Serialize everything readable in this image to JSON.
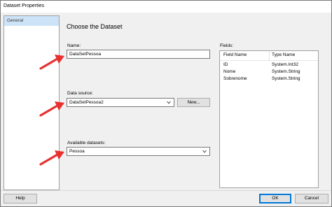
{
  "window": {
    "title": "Dataset Properties"
  },
  "sidebar": {
    "items": [
      {
        "label": "General"
      }
    ]
  },
  "main": {
    "heading": "Choose the Dataset",
    "name_label": "Name:",
    "name_value": "DataSetPessoa",
    "datasource_label": "Data source:",
    "datasource_value": "DataSetPessoa2",
    "new_button": "New...",
    "available_label": "Available datasets:",
    "available_value": "Pessoa"
  },
  "fields": {
    "label": "Fields:",
    "columns": [
      "Field Name",
      "Type Name"
    ],
    "rows": [
      [
        "ID",
        "System.Int32"
      ],
      [
        "Nome",
        "System.String"
      ],
      [
        "Sobrenome",
        "System.String"
      ]
    ]
  },
  "footer": {
    "help": "Help",
    "ok": "OK",
    "cancel": "Cancel"
  },
  "colors": {
    "accent_arrow": "#e8302f",
    "selection": "#cde3f7",
    "ok_border": "#0078d7"
  }
}
